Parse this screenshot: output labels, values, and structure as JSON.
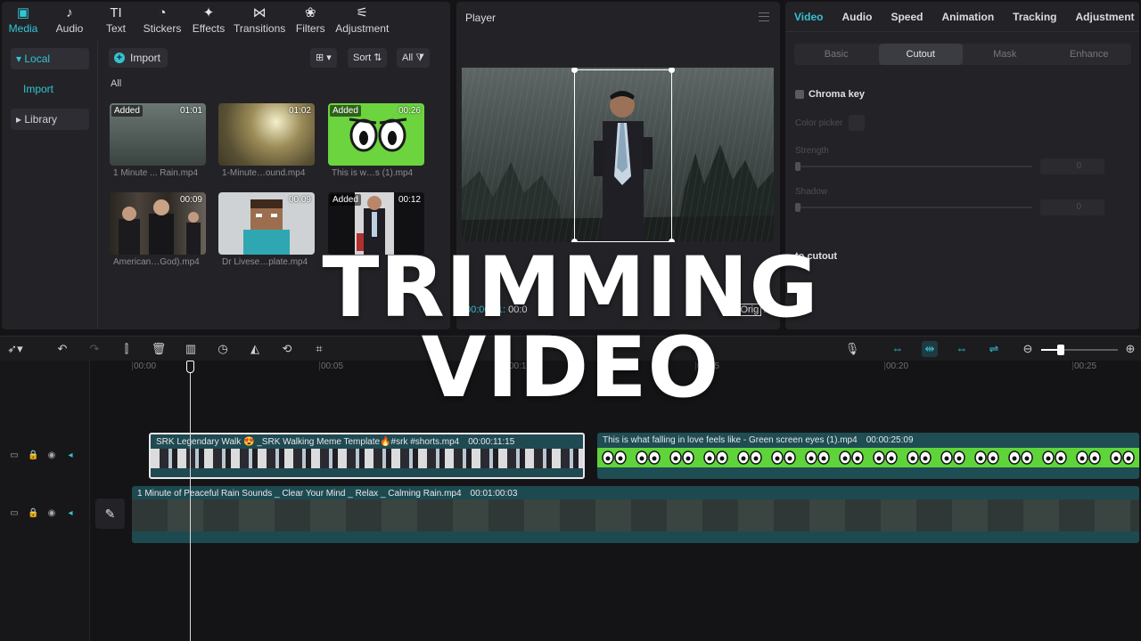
{
  "media": {
    "tabs": [
      {
        "label": "Media",
        "icon": "▣"
      },
      {
        "label": "Audio",
        "icon": "♪"
      },
      {
        "label": "Text",
        "icon": "TI"
      },
      {
        "label": "Stickers",
        "icon": "◔"
      },
      {
        "label": "Effects",
        "icon": "✦"
      },
      {
        "label": "Transitions",
        "icon": "⋈"
      },
      {
        "label": "Filters",
        "icon": "❀"
      },
      {
        "label": "Adjustment",
        "icon": "⚟"
      }
    ],
    "nav": {
      "local": "Local",
      "import": "Import",
      "library": "Library"
    },
    "import_button": "Import",
    "sort_label": "Sort",
    "filter_label": "All",
    "section_label": "All",
    "thumbnails": [
      {
        "name": "1 Minute ... Rain.mp4",
        "duration": "01:01",
        "added": "Added"
      },
      {
        "name": "1-Minute…ound.mp4",
        "duration": "01:02",
        "added": ""
      },
      {
        "name": "This is w…s (1).mp4",
        "duration": "00:26",
        "added": "Added"
      },
      {
        "name": "American…God).mp4",
        "duration": "00:09",
        "added": ""
      },
      {
        "name": "Dr Livese…plate.mp4",
        "duration": "00:09",
        "added": ""
      },
      {
        "name": "",
        "duration": "00:12",
        "added": "Added"
      }
    ]
  },
  "player": {
    "title": "Player",
    "time_current": "00:00:11:",
    "time_total": "00:0",
    "ratio_label": "Orig"
  },
  "inspector": {
    "tabs": [
      "Video",
      "Audio",
      "Speed",
      "Animation",
      "Tracking",
      "Adjustment"
    ],
    "segments": [
      "Basic",
      "Cutout",
      "Mask",
      "Enhance"
    ],
    "chroma_key": "Chroma key",
    "color_picker": "Color picker",
    "strength": "Strength",
    "strength_value": "0",
    "shadow": "Shadow",
    "shadow_value": "0",
    "auto_cutout": "to cutout"
  },
  "timeline": {
    "ruler": [
      "00:00",
      "00:05",
      "00:10",
      "00:15",
      "00:20",
      "00:25"
    ],
    "clips": {
      "srk": {
        "name": "SRK Legendary Walk 😍 _SRK Walking Meme Template🔥#srk #shorts.mp4",
        "duration": "00:00:11:15"
      },
      "green": {
        "name": "This is what falling in love feels like - Green screen eyes (1).mp4",
        "duration": "00:00:25:09"
      },
      "rain": {
        "name": "1 Minute of Peaceful Rain Sounds _ Clear Your Mind _ Relax _ Calming Rain.mp4",
        "duration": "00:01:00:03"
      }
    }
  },
  "overlay": {
    "line1": "TRIMMING",
    "line2": "VIDEO"
  },
  "colors": {
    "accent": "#35c2d0",
    "green_screen": "#5fd43a",
    "track_teal": "#1f4d52"
  }
}
